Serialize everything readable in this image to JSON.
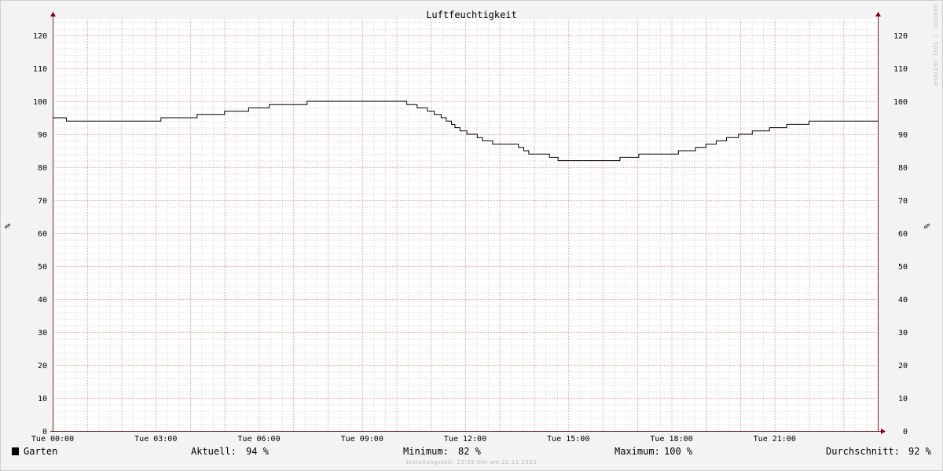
{
  "chart_data": {
    "type": "line",
    "title": "Luftfeuchtigkeit",
    "ylabel": "%",
    "ylim": [
      0,
      125
    ],
    "yticks": [
      0,
      10,
      20,
      30,
      40,
      50,
      60,
      70,
      80,
      90,
      100,
      110,
      120
    ],
    "xlim": [
      0,
      24
    ],
    "xticks": [
      {
        "x": 0,
        "label": "Tue 00:00"
      },
      {
        "x": 3,
        "label": "Tue 03:00"
      },
      {
        "x": 6,
        "label": "Tue 06:00"
      },
      {
        "x": 9,
        "label": "Tue 09:00"
      },
      {
        "x": 12,
        "label": "Tue 12:00"
      },
      {
        "x": 15,
        "label": "Tue 15:00"
      },
      {
        "x": 18,
        "label": "Tue 18:00"
      },
      {
        "x": 21,
        "label": "Tue 21:00"
      }
    ],
    "grid": true,
    "series": [
      {
        "name": "Garten",
        "color": "#000000",
        "step": true,
        "points": [
          [
            0,
            95
          ],
          [
            0.4,
            94
          ],
          [
            3.15,
            95
          ],
          [
            4.2,
            96
          ],
          [
            5.0,
            97
          ],
          [
            5.7,
            98
          ],
          [
            6.3,
            99
          ],
          [
            7.4,
            100
          ],
          [
            10.3,
            99
          ],
          [
            10.6,
            98
          ],
          [
            10.9,
            97
          ],
          [
            11.1,
            96
          ],
          [
            11.3,
            95
          ],
          [
            11.45,
            94
          ],
          [
            11.6,
            93
          ],
          [
            11.7,
            92
          ],
          [
            11.85,
            91
          ],
          [
            12.05,
            90
          ],
          [
            12.35,
            89
          ],
          [
            12.5,
            88
          ],
          [
            12.8,
            87
          ],
          [
            13.55,
            86
          ],
          [
            13.7,
            85
          ],
          [
            13.85,
            84
          ],
          [
            14.45,
            83
          ],
          [
            14.7,
            82
          ],
          [
            16.5,
            83
          ],
          [
            17.05,
            84
          ],
          [
            18.2,
            85
          ],
          [
            18.7,
            86
          ],
          [
            19.0,
            87
          ],
          [
            19.3,
            88
          ],
          [
            19.6,
            89
          ],
          [
            19.95,
            90
          ],
          [
            20.35,
            91
          ],
          [
            20.85,
            92
          ],
          [
            21.35,
            93
          ],
          [
            22.0,
            94
          ],
          [
            24,
            94
          ]
        ]
      }
    ]
  },
  "legend": {
    "series_name": "Garten",
    "current_label": "Aktuell:",
    "current_value": "94 %",
    "min_label": "Minimum:",
    "min_value": "82 %",
    "max_label": "Maximum:",
    "max_value": "100 %",
    "avg_label": "Durchschnitt:",
    "avg_value": "92 %"
  },
  "watermark": "RRDTOOL / TOBI OETIKER",
  "footer": "Erstellungszeit: 23:55 Uhr am 22.11.2022"
}
